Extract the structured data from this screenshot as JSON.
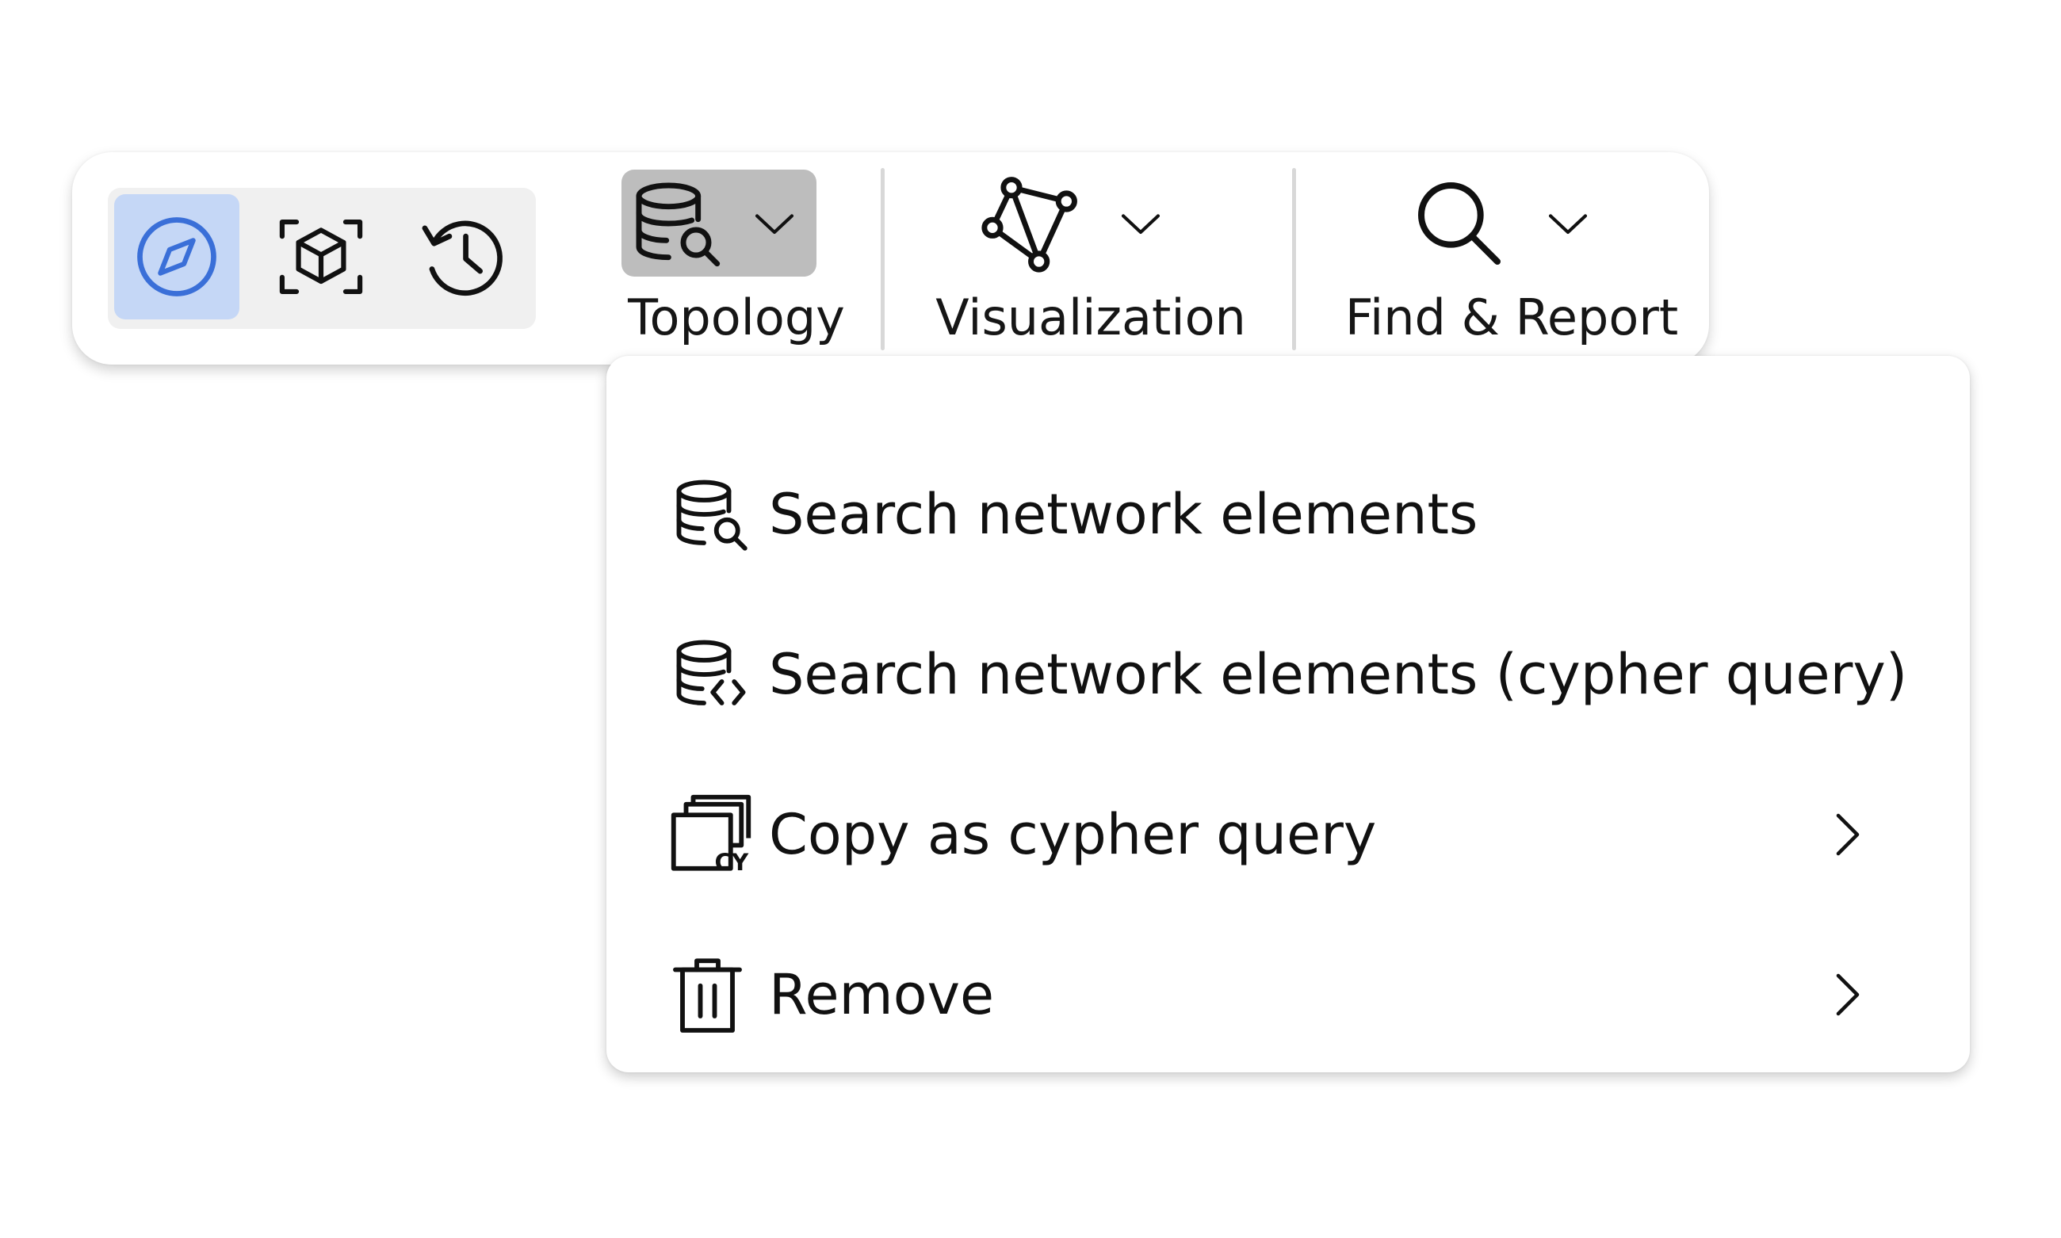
{
  "toolbar": {
    "modes": [
      {
        "icon": "compass-icon",
        "active": true
      },
      {
        "icon": "3d-box-icon",
        "active": false
      },
      {
        "icon": "history-icon",
        "active": false
      }
    ],
    "topology": {
      "label": "Topology",
      "icon": "database-search-icon",
      "pressed": true
    },
    "visualization": {
      "label": "Visualization",
      "icon": "graph-nodes-icon"
    },
    "find_report": {
      "label": "Find & Report",
      "icon": "search-icon"
    }
  },
  "menu": {
    "items": [
      {
        "label": "Search network elements",
        "icon": "database-search-icon",
        "submenu": false
      },
      {
        "label": "Search network elements (cypher query)",
        "icon": "database-code-icon",
        "submenu": false
      },
      {
        "label": "Copy as cypher query",
        "icon": "copy-cypher-icon",
        "submenu": true
      },
      {
        "label": "Remove",
        "icon": "trash-icon",
        "submenu": true
      }
    ]
  },
  "colors": {
    "active_mode_bg": "#c5d7f6",
    "active_mode_icon": "#3a6fd8",
    "pressed_button_bg": "#bdbdbd",
    "mode_group_bg": "#f0f0f0",
    "separator": "#d8d8d8"
  }
}
